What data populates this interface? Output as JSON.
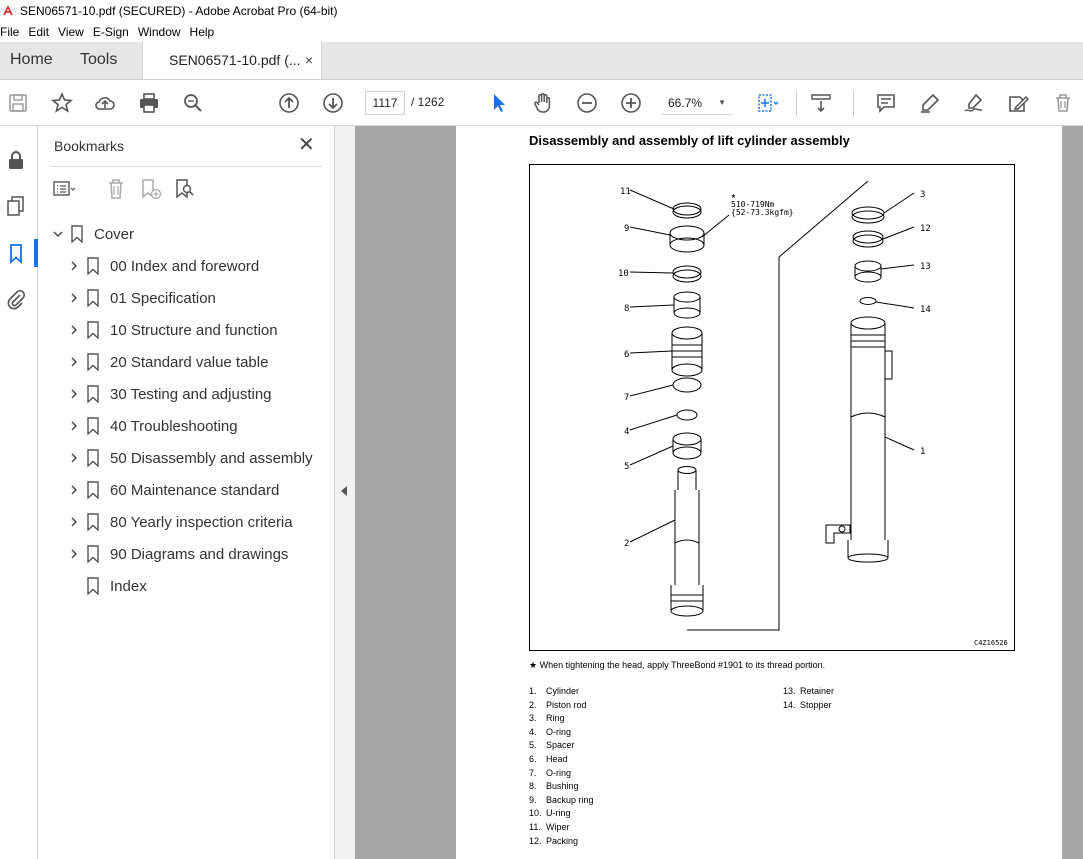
{
  "window": {
    "title": "SEN06571-10.pdf (SECURED) - Adobe Acrobat Pro (64-bit)"
  },
  "menu": [
    "File",
    "Edit",
    "View",
    "E-Sign",
    "Window",
    "Help"
  ],
  "tabs": {
    "home": "Home",
    "tools": "Tools",
    "document": "SEN06571-10.pdf (...",
    "close_glyph": "×"
  },
  "toolbar": {
    "current_page": "1117",
    "total_pages": "/ 1262",
    "zoom": "66.7%",
    "icons": [
      "save-icon",
      "bookmark-star-icon",
      "upload-icon",
      "print-icon",
      "search-icon",
      "page-up-icon",
      "page-down-icon",
      "select-cursor-icon",
      "hand-icon",
      "zoom-out-icon",
      "zoom-in-icon",
      "fit-page-icon",
      "scroll-mode-icon",
      "comment-icon",
      "highlight-icon",
      "sign-icon",
      "fill-sign-icon",
      "delete-icon"
    ]
  },
  "bookmarks": {
    "title": "Bookmarks",
    "close_glyph": "✕",
    "items": [
      {
        "label": "Cover",
        "expanded": true,
        "level": 0,
        "has_children": true
      },
      {
        "label": "00 Index and foreword",
        "level": 1,
        "has_children": true
      },
      {
        "label": "01 Specification",
        "level": 1,
        "has_children": true
      },
      {
        "label": "10 Structure and function",
        "level": 1,
        "has_children": true
      },
      {
        "label": "20 Standard value table",
        "level": 1,
        "has_children": true
      },
      {
        "label": "30 Testing and adjusting",
        "level": 1,
        "has_children": true
      },
      {
        "label": "40 Troubleshooting",
        "level": 1,
        "has_children": true
      },
      {
        "label": "50 Disassembly and assembly",
        "level": 1,
        "has_children": true
      },
      {
        "label": "60 Maintenance standard",
        "level": 1,
        "has_children": true
      },
      {
        "label": "80 Yearly inspection criteria",
        "level": 1,
        "has_children": true
      },
      {
        "label": "90 Diagrams and drawings",
        "level": 1,
        "has_children": true
      },
      {
        "label": "Index",
        "level": 1,
        "has_children": false
      }
    ]
  },
  "document": {
    "heading": "Disassembly and assembly of lift cylinder assembly",
    "figure": {
      "torque_star": "★",
      "torque_line1": "510-719Nm",
      "torque_line2": "{52-73.3kgfm}",
      "figure_code": "C4Z16526",
      "callouts": [
        "11",
        "9",
        "10",
        "8",
        "6",
        "7",
        "4",
        "5",
        "2",
        "3",
        "12",
        "13",
        "14",
        "1"
      ]
    },
    "note": "★  When tightening the head, apply ThreeBond #1901 to its thread portion.",
    "parts_left": [
      {
        "num": "1.",
        "name": "Cylinder"
      },
      {
        "num": "2.",
        "name": "Piston rod"
      },
      {
        "num": "3.",
        "name": "Ring"
      },
      {
        "num": "4.",
        "name": "O-ring"
      },
      {
        "num": "5.",
        "name": "Spacer"
      },
      {
        "num": "6.",
        "name": "Head"
      },
      {
        "num": "7.",
        "name": "O-ring"
      },
      {
        "num": "8.",
        "name": "Bushing"
      },
      {
        "num": "9.",
        "name": "Backup ring"
      },
      {
        "num": "10.",
        "name": "U-ring"
      },
      {
        "num": "11.",
        "name": "Wiper"
      },
      {
        "num": "12.",
        "name": "Packing"
      }
    ],
    "parts_right": [
      {
        "num": "13.",
        "name": "Retainer"
      },
      {
        "num": "14.",
        "name": "Stopper"
      }
    ]
  },
  "colors": {
    "accent": "#1473e6",
    "app_icon": "#d7261e",
    "tab_bg": "#e6e6e6",
    "doc_bg": "#a6a6a6"
  }
}
